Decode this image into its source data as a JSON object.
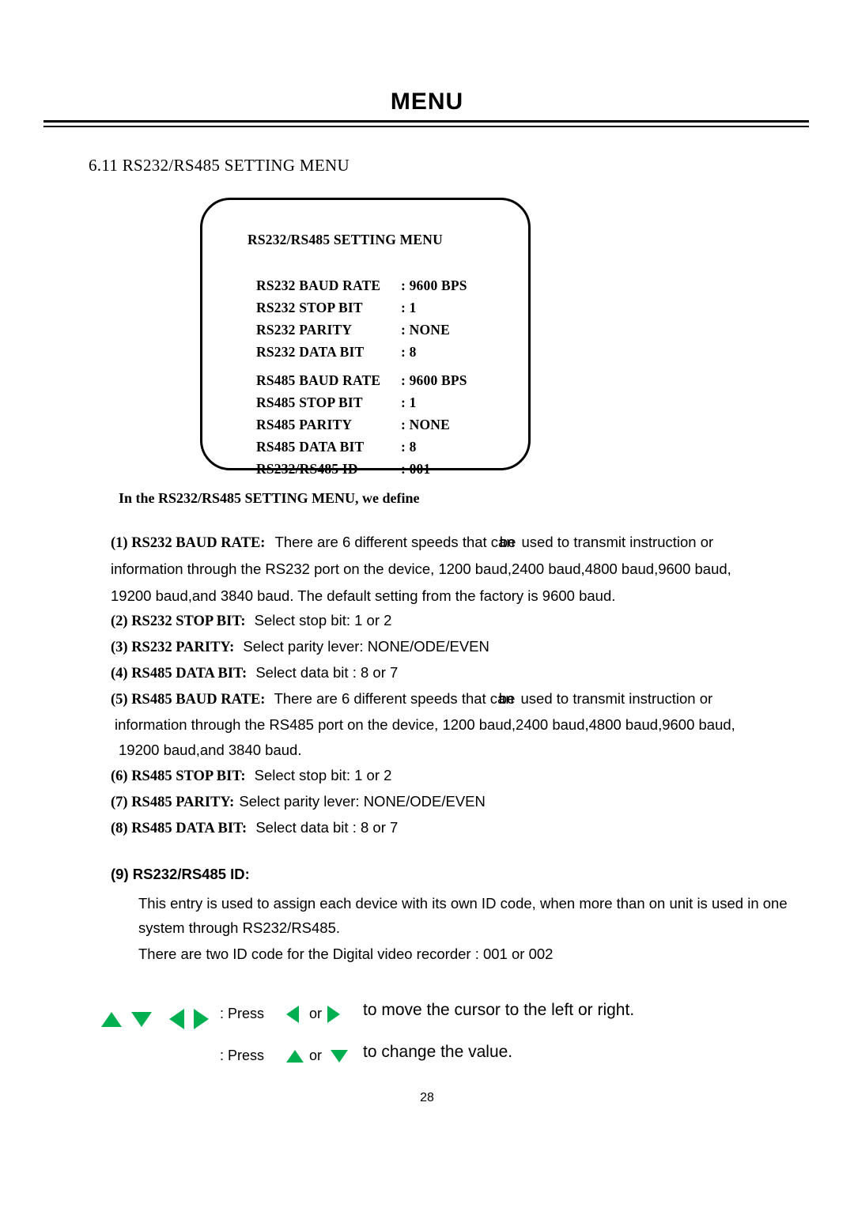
{
  "header": {
    "title": "MENU"
  },
  "section": {
    "heading": "6.11 RS232/RS485 SETTING MENU"
  },
  "osd": {
    "title": "RS232/RS485  SETTING MENU",
    "rows": [
      {
        "label": "RS232 BAUD RATE",
        "value": ": 9600 BPS"
      },
      {
        "label": "RS232 STOP BIT",
        "value": ": 1"
      },
      {
        "label": "RS232 PARITY",
        "value": ": NONE"
      },
      {
        "label": "RS232 DATA BIT",
        "value": ": 8"
      },
      {
        "label": "RS485 BAUD RATE",
        "value": ": 9600 BPS"
      },
      {
        "label": "RS485 STOP BIT",
        "value": ": 1"
      },
      {
        "label": "RS485 PARITY",
        "value": ": NONE"
      },
      {
        "label": "RS485 DATA BIT",
        "value": ": 8"
      },
      {
        "label": "RS232/RS485 ID",
        "value": ": 001"
      }
    ]
  },
  "body": {
    "define_line": "In the RS232/RS485  SETTING MENU, we define",
    "item1_head": "(1) RS232 BAUD RATE:",
    "item1_l1a": "There are 6 different speeds that can",
    "item1_l1b": "be",
    "item1_l1c": "used to transmit instruction or",
    "item1_l2": "information through the RS232 port on the device, 1200 baud,2400 baud,4800 baud,9600 baud,",
    "item1_l3": "19200 baud,and 3840 baud. The default setting from the factory is 9600 baud.",
    "item2_head": "(2) RS232 STOP BIT:",
    "item2_text": "Select stop bit: 1 or 2",
    "item3_head": "(3) RS232 PARITY:",
    "item3_text": "Select parity lever: NONE/ODE/EVEN",
    "item4_head": "(4) RS485 DATA BIT:",
    "item4_text": "Select data bit : 8 or 7",
    "item5_head": "(5) RS485 BAUD RATE:",
    "item5_l1a": "There are 6 different speeds that can",
    "item5_l1b": "be",
    "item5_l1c": "used to transmit instruction or",
    "item5_l2": "information through the RS485 port on the device, 1200 baud,2400 baud,4800 baud,9600 baud,",
    "item5_l3": "19200 baud,and 3840 baud.",
    "item6_head": "(6) RS485 STOP BIT:",
    "item6_text": "Select stop bit: 1 or 2",
    "item7_head": "(7) RS485 PARITY:",
    "item7_text": "Select parity lever: NONE/ODE/EVEN",
    "item8_head": "(8) RS485 DATA BIT:",
    "item8_text": "Select data bit : 8 or 7",
    "item9_head": "(9) RS232/RS485 ID:",
    "item9_l1": "This entry is used to assign each device with its own ID code, when more than on unit  is used in one",
    "item9_l2": "system through RS232/RS485.",
    "item9_l3": "There are two ID code  for the Digital video recorder : 001 or 002"
  },
  "instructions": {
    "press1_label": ": Press",
    "press1_or": "or",
    "press1_text": "to move the cursor to the left or right.",
    "press2_label": ": Press",
    "press2_or": "or",
    "press2_text": "to change the value."
  },
  "footer": {
    "page_number": "28"
  },
  "colors": {
    "arrow_green": "#00b050",
    "text": "#000000",
    "background": "#ffffff"
  }
}
